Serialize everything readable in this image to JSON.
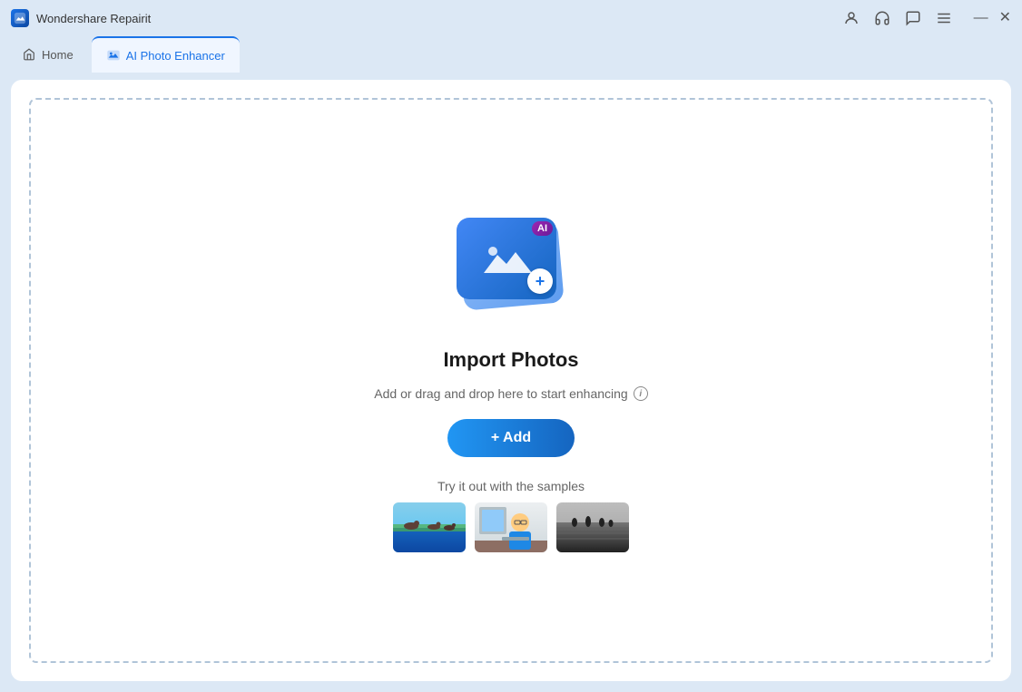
{
  "titleBar": {
    "appTitle": "Wondershare Repairit",
    "icons": {
      "user": "👤",
      "headphones": "🎧",
      "chat": "💬",
      "menu": "☰"
    },
    "windowControls": {
      "minimize": "—",
      "close": "✕"
    }
  },
  "tabs": {
    "home": {
      "label": "Home",
      "icon": "🏠"
    },
    "aiPhotoEnhancer": {
      "label": "AI Photo Enhancer"
    }
  },
  "mainContent": {
    "importTitle": "Import Photos",
    "importSubtitle": "Add or drag and drop here to start enhancing",
    "addButton": "+ Add",
    "samplesLabel": "Try it out with the samples",
    "aiBadge": "AI"
  }
}
